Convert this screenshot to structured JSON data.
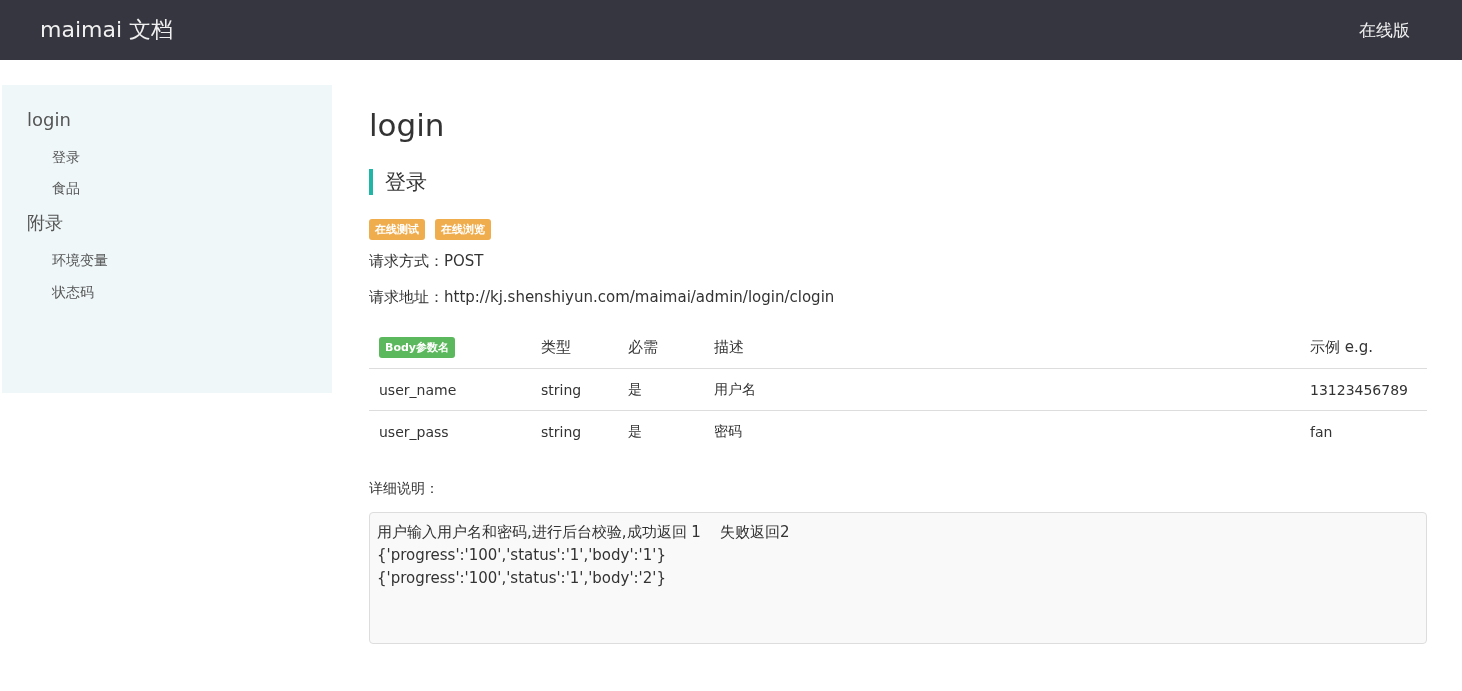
{
  "navbar": {
    "brand": "maimai 文档",
    "link": "在线版"
  },
  "sidebar": {
    "groups": [
      {
        "title": "login",
        "items": [
          "登录",
          "食品"
        ]
      },
      {
        "title": "附录",
        "items": [
          "环境变量",
          "状态码"
        ]
      }
    ]
  },
  "page": {
    "title": "login",
    "section": "登录",
    "tags": [
      "在线测试",
      "在线浏览"
    ],
    "fields": [
      {
        "label": "请求方式：",
        "value": "POST"
      },
      {
        "label": "请求地址：",
        "value": "http://kj.shenshiyun.com/maimai/admin/login/clogin"
      }
    ],
    "table": {
      "columns": [
        {
          "label": "Body参数名",
          "kind": "badge"
        },
        {
          "label": "类型",
          "kind": "text"
        },
        {
          "label": "必需",
          "kind": "text"
        },
        {
          "label": "描述",
          "kind": "text"
        },
        {
          "label": "示例 e.g.",
          "kind": "text"
        }
      ],
      "rows": [
        [
          "user_name",
          "string",
          "是",
          "用户名",
          "13123456789"
        ],
        [
          "user_pass",
          "string",
          "是",
          "密码",
          "fan"
        ]
      ]
    },
    "details_label": "详细说明：",
    "details": [
      "用户输入用户名和密码,进行后台校验,成功返回 1    失败返回2",
      "{'progress':'100','status':'1','body':'1'}",
      "{'progress':'100','status':'1','body':'2'}"
    ]
  }
}
